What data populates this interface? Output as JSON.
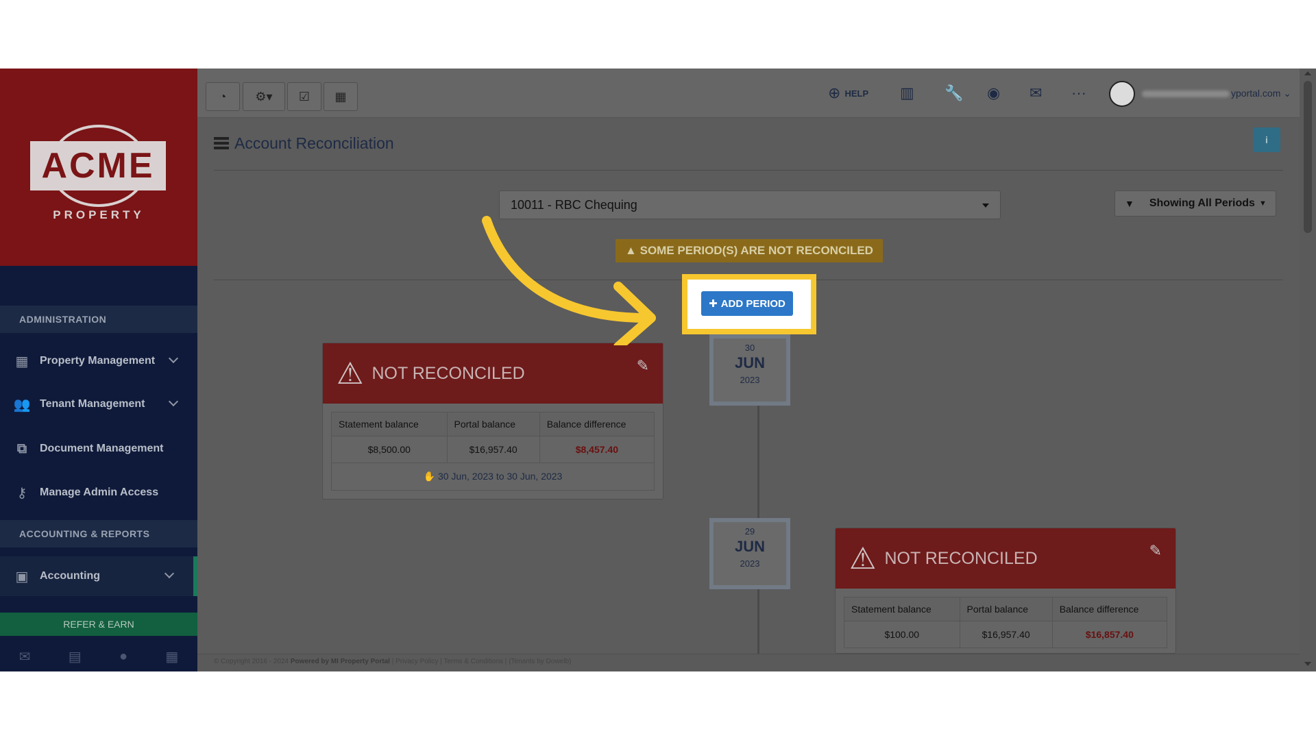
{
  "brand": {
    "logo_text": "ACME",
    "logo_sub": "PROPERTY",
    "colors": {
      "sidebar": "#0f1a3a",
      "logo_bg": "#7a1416",
      "accent_green": "#12603f",
      "primary_blue": "#2c77c7",
      "highlight_yellow": "#f7c72f",
      "danger_red": "#6e1b1b"
    }
  },
  "sidebar": {
    "section_admin": "ADMINISTRATION",
    "section_accounting": "ACCOUNTING & REPORTS",
    "items": [
      {
        "label": "Property Management",
        "icon": "building-icon"
      },
      {
        "label": "Tenant Management",
        "icon": "users-icon"
      },
      {
        "label": "Document Management",
        "icon": "documents-icon"
      },
      {
        "label": "Manage Admin Access",
        "icon": "key-icon"
      },
      {
        "label": "Accounting",
        "icon": "money-icon"
      }
    ],
    "refer_label": "REFER & EARN"
  },
  "topbar": {
    "help_label": "HELP",
    "email_suffix": "yportal.com"
  },
  "page": {
    "title": "Account Reconciliation",
    "info_label": "i",
    "account_selected": "10011 - RBC Chequing",
    "filter_label": "Showing All Periods",
    "warning_banner": "SOME PERIOD(S) ARE NOT RECONCILED",
    "add_period_label": "ADD PERIOD"
  },
  "periods": [
    {
      "status": "NOT RECONCILED",
      "day": "30",
      "month": "JUN",
      "year": "2023",
      "headers": [
        "Statement balance",
        "Portal balance",
        "Balance difference"
      ],
      "statement_balance": "$8,500.00",
      "portal_balance": "$16,957.40",
      "balance_difference": "$8,457.40",
      "range": "30 Jun, 2023 to 30 Jun, 2023"
    },
    {
      "status": "NOT RECONCILED",
      "day": "29",
      "month": "JUN",
      "year": "2023",
      "headers": [
        "Statement balance",
        "Portal balance",
        "Balance difference"
      ],
      "statement_balance": "$100.00",
      "portal_balance": "$16,957.40",
      "balance_difference": "$16,857.40"
    }
  ],
  "footer": {
    "copyright": "© Copyright 2016 - 2024",
    "powered": "Powered by MI Property Portal",
    "privacy": "Privacy Policy",
    "terms": "Terms & Conditions",
    "tenants": "(Tenants by Dowelb)"
  }
}
